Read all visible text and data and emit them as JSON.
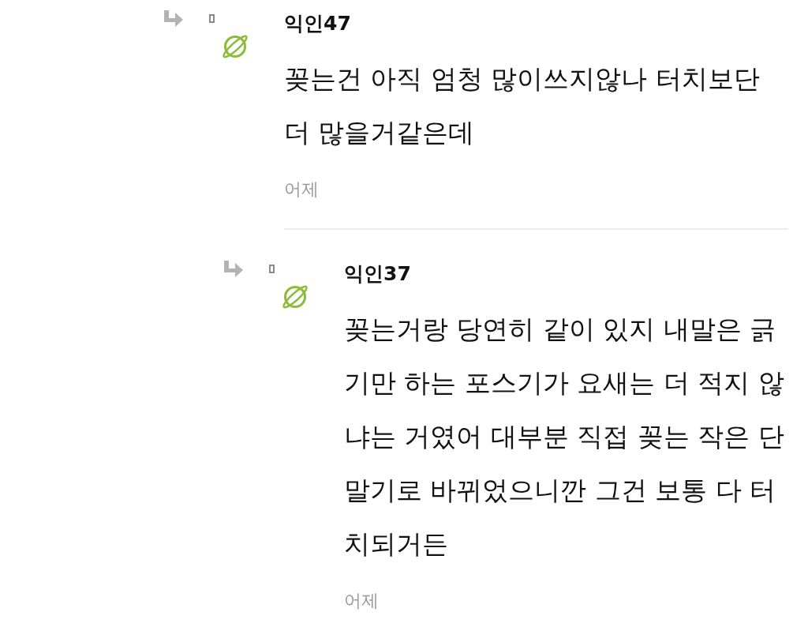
{
  "comments": [
    {
      "author": "익인47",
      "text": "꽂는건 아직 엄청 많이쓰지않나 터치보단 더 많을거같은데",
      "time": "어제",
      "children": [
        {
          "author": "익인37",
          "text": "꽂는거랑 당연히 같이 있지 내말은 긁기만 하는 포스기가 요새는 더 적지 않냐는 거였어 대부분 직접 꽂는 작은 단말기로 바뀌었으니깐 그건 보통 다 터치되거든",
          "time": "어제"
        }
      ]
    }
  ]
}
